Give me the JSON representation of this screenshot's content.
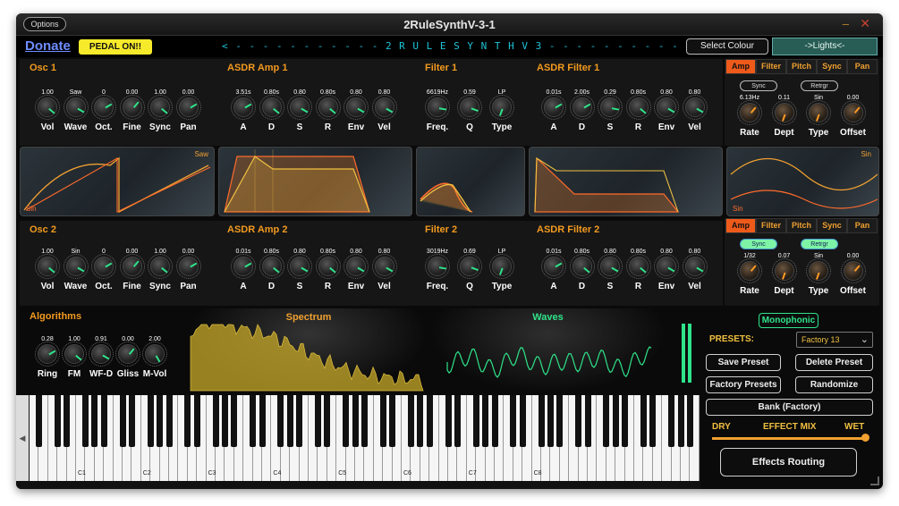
{
  "window": {
    "title": "2RuleSynthV-3-1",
    "options_label": "Options",
    "minimize_glyph": "–",
    "close_glyph": "✕"
  },
  "topbar": {
    "donate": "Donate",
    "pedal": "PEDAL ON!!",
    "banner": "< - - - - - - - - - - - 2 R U L E S Y N T H   V 3 - - - - - - - - - - - - >",
    "select_colour": "Select Colour",
    "lights": "->Lights<-"
  },
  "osc1": {
    "title": "Osc 1",
    "knobs": [
      {
        "value": "1.00",
        "label": "Vol"
      },
      {
        "value": "Saw",
        "label": "Wave"
      },
      {
        "value": "0",
        "label": "Oct."
      },
      {
        "value": "0.00",
        "label": "Fine"
      },
      {
        "value": "1.00",
        "label": "Sync"
      },
      {
        "value": "0.00",
        "label": "Pan"
      }
    ]
  },
  "amp1": {
    "title": "ASDR Amp 1",
    "knobs": [
      {
        "value": "3.51s",
        "label": "A"
      },
      {
        "value": "0.80s",
        "label": "D"
      },
      {
        "value": "0.80",
        "label": "S"
      },
      {
        "value": "0.80s",
        "label": "R"
      },
      {
        "value": "0.80",
        "label": "Env"
      },
      {
        "value": "0.80",
        "label": "Vel"
      }
    ]
  },
  "filter1": {
    "title": "Filter 1",
    "knobs": [
      {
        "value": "6619Hz",
        "label": "Freq."
      },
      {
        "value": "0.59",
        "label": "Q"
      },
      {
        "value": "LP",
        "label": "Type"
      }
    ]
  },
  "fenv1": {
    "title": "ASDR Filter 1",
    "knobs": [
      {
        "value": "0.01s",
        "label": "A"
      },
      {
        "value": "2.00s",
        "label": "D"
      },
      {
        "value": "0.29",
        "label": "S"
      },
      {
        "value": "0.80s",
        "label": "R"
      },
      {
        "value": "0.80",
        "label": "Env"
      },
      {
        "value": "0.80",
        "label": "Vel"
      }
    ]
  },
  "lfo1": {
    "tabs": [
      "Amp",
      "Filter",
      "Pitch",
      "Sync",
      "Pan"
    ],
    "sync": "Sync",
    "retrgr": "Retrgr",
    "knobs": [
      {
        "value": "6.13Hz",
        "label": "Rate"
      },
      {
        "value": "0.11",
        "label": "Dept"
      },
      {
        "value": "Sin",
        "label": "Type"
      },
      {
        "value": "0.00",
        "label": "Offset"
      }
    ],
    "display_labels": {
      "top": "Sin",
      "bottom": "Sin"
    }
  },
  "osc_display1": {
    "top_label": "Saw",
    "bottom_label": "Sin"
  },
  "osc2": {
    "title": "Osc 2",
    "knobs": [
      {
        "value": "1.00",
        "label": "Vol"
      },
      {
        "value": "Sin",
        "label": "Wave"
      },
      {
        "value": "0",
        "label": "Oct."
      },
      {
        "value": "0.00",
        "label": "Fine"
      },
      {
        "value": "1.00",
        "label": "Sync"
      },
      {
        "value": "0.00",
        "label": "Pan"
      }
    ]
  },
  "amp2": {
    "title": "ASDR Amp 2",
    "knobs": [
      {
        "value": "0.01s",
        "label": "A"
      },
      {
        "value": "0.80s",
        "label": "D"
      },
      {
        "value": "0.80",
        "label": "S"
      },
      {
        "value": "0.80s",
        "label": "R"
      },
      {
        "value": "0.80",
        "label": "Env"
      },
      {
        "value": "0.80",
        "label": "Vel"
      }
    ]
  },
  "filter2": {
    "title": "Filter 2",
    "knobs": [
      {
        "value": "3019Hz",
        "label": "Freq."
      },
      {
        "value": "0.69",
        "label": "Q"
      },
      {
        "value": "LP",
        "label": "Type"
      }
    ]
  },
  "fenv2": {
    "title": "ASDR Filter 2",
    "knobs": [
      {
        "value": "0.01s",
        "label": "A"
      },
      {
        "value": "0.80s",
        "label": "D"
      },
      {
        "value": "0.80",
        "label": "S"
      },
      {
        "value": "0.80s",
        "label": "R"
      },
      {
        "value": "0.80",
        "label": "Env"
      },
      {
        "value": "0.80",
        "label": "Vel"
      }
    ]
  },
  "lfo2": {
    "tabs": [
      "Amp",
      "Filter",
      "Pitch",
      "Sync",
      "Pan"
    ],
    "sync": "Sync",
    "retrgr": "Retrgr",
    "knobs": [
      {
        "value": "1/32",
        "label": "Rate"
      },
      {
        "value": "0.07",
        "label": "Dept"
      },
      {
        "value": "Sin",
        "label": "Type"
      },
      {
        "value": "0.00",
        "label": "Offset"
      }
    ]
  },
  "algorithms": {
    "title": "Algorithms",
    "knobs": [
      {
        "value": "0.28",
        "label": "Ring"
      },
      {
        "value": "1.00",
        "label": "FM"
      },
      {
        "value": "0.91",
        "label": "WF-D"
      },
      {
        "value": "0.00",
        "label": "Gliss"
      },
      {
        "value": "2.00",
        "label": "M-Vol"
      }
    ]
  },
  "spectrum": {
    "title": "Spectrum"
  },
  "waves": {
    "title": "Waves"
  },
  "presets": {
    "mono": "Monophonic",
    "label": "PRESETS:",
    "selected": "Factory 13",
    "save": "Save Preset",
    "delete": "Delete Preset",
    "factory": "Factory Presets",
    "randomize": "Randomize",
    "bank": "Bank (Factory)",
    "dry": "DRY",
    "mix": "EFFECT MIX",
    "wet": "WET",
    "mix_value": 1.0,
    "routing": "Effects Routing"
  },
  "keyboard": {
    "octave_labels": [
      "C1",
      "C2",
      "C3",
      "C4",
      "C5",
      "C6",
      "C7",
      "C8"
    ],
    "scroll_glyph": "◀"
  },
  "colors": {
    "accent": "#f29a1f",
    "knob_pointer": "#2fe38a",
    "tab_active": "#ee5a1a",
    "banner": "#1ec4d9"
  }
}
